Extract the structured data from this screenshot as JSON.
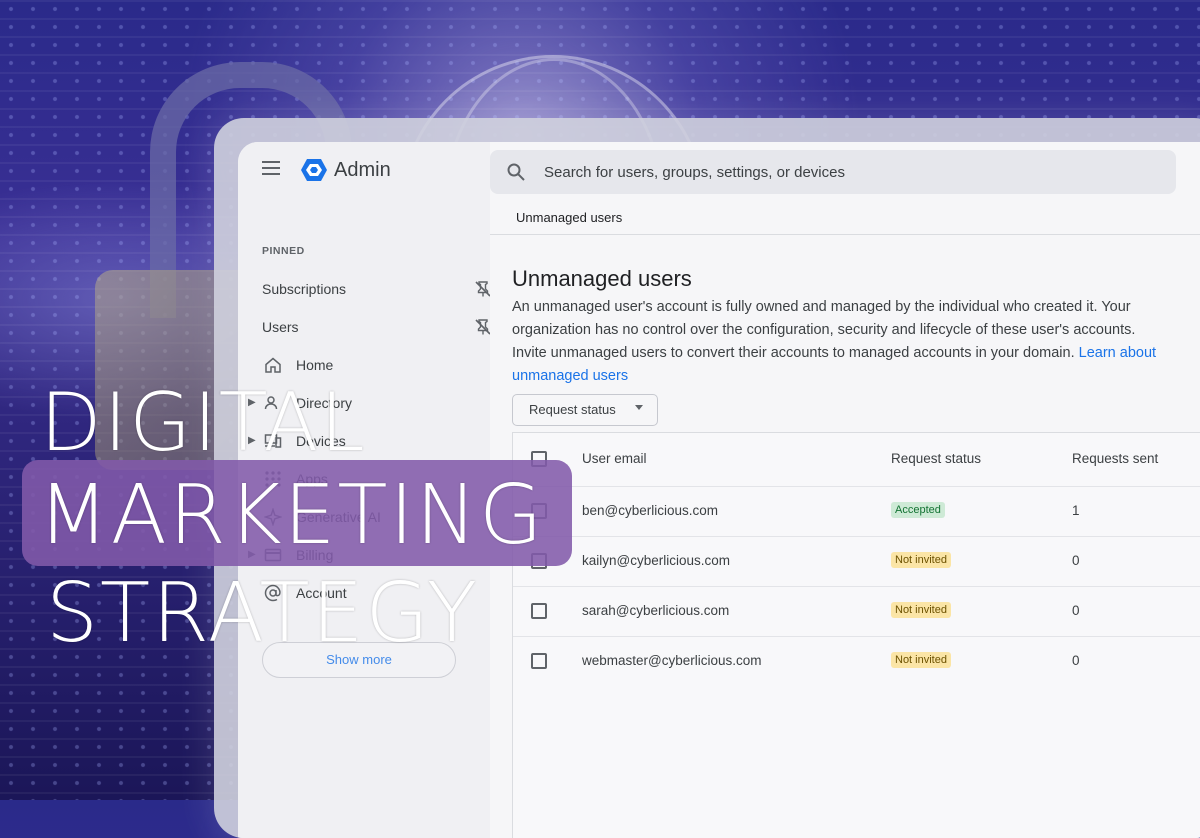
{
  "colors": {
    "accent": "#1a73e8",
    "badge_accepted": "#ceead6",
    "badge_not_invited": "#fbe5a6",
    "overlay_pill": "#825aaa"
  },
  "app": {
    "title": "Admin",
    "logo_icon": "admin-hexagon-logo"
  },
  "search": {
    "placeholder": "Search for users, groups, settings, or devices"
  },
  "sidebar": {
    "pinned_label": "PINNED",
    "pinned_items": [
      {
        "label": "Subscriptions",
        "icon": "unpin-icon"
      },
      {
        "label": "Users",
        "icon": "unpin-icon"
      }
    ],
    "items": [
      {
        "label": "Home",
        "icon": "home-icon"
      },
      {
        "label": "Directory",
        "icon": "directory-icon"
      },
      {
        "label": "Devices",
        "icon": "devices-icon"
      },
      {
        "label": "Apps",
        "icon": "apps-grid-icon"
      },
      {
        "label": "Generative AI",
        "icon": "sparkle-icon"
      },
      {
        "label": "Billing",
        "icon": "billing-card-icon"
      },
      {
        "label": "Account",
        "icon": "at-sign-icon"
      }
    ],
    "show_more": "Show more"
  },
  "main": {
    "breadcrumb": "Unmanaged users",
    "title": "Unmanaged users",
    "description": "An unmanaged user's account is fully owned and managed by the individual who created it. Your organization has no control over the configuration, security and lifecycle of these user's accounts. Invite unmanaged users to convert their accounts to managed accounts in your domain.",
    "learn_link": "Learn about unmanaged users",
    "filter_label": "Request status",
    "table": {
      "headers": [
        "User email",
        "Request status",
        "Requests sent"
      ],
      "rows": [
        {
          "email": "ben@cyberlicious.com",
          "status": "Accepted",
          "sent": "1"
        },
        {
          "email": "kailyn@cyberlicious.com",
          "status": "Not invited",
          "sent": "0"
        },
        {
          "email": "sarah@cyberlicious.com",
          "status": "Not invited",
          "sent": "0"
        },
        {
          "email": "webmaster@cyberlicious.com",
          "status": "Not invited",
          "sent": "0"
        }
      ]
    }
  },
  "overlay": {
    "line1": "DIGITAL",
    "line2": "MARKETING",
    "line3": "STRATEGY"
  }
}
